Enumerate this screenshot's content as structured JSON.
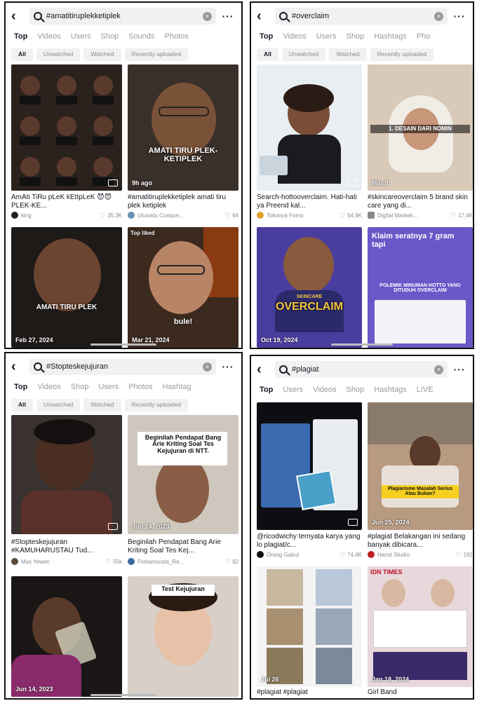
{
  "panels": [
    {
      "query": "#amatitiruplekketiplek",
      "tabs": [
        "Top",
        "Videos",
        "Users",
        "Shop",
        "Sounds",
        "Photos"
      ],
      "chips": [
        "All",
        "Unwatched",
        "Watched",
        "Recently uploaded"
      ],
      "cards": [
        {
          "overlay": "",
          "label": "",
          "caption": "AmAti TiRu pLeK kEtIpLeK 😈😈 PLEK-KE...",
          "user": "king",
          "likes": "35,3K"
        },
        {
          "overlay": "AMATI TIRU PLEK-KETIPLEK",
          "label": "9h ago",
          "caption": "#amatitiruplekketiplek amati tiru plek ketiplek",
          "user": "Uluwatu Conque...",
          "likes": "64"
        },
        {
          "overlay": "AMATI TIRU PLEK",
          "label": "Feb 27, 2024",
          "caption": "",
          "user": "",
          "likes": ""
        },
        {
          "overlay": "bule!",
          "label": "Mar 21, 2024",
          "badge": "Top liked",
          "caption": "",
          "user": "",
          "likes": ""
        }
      ]
    },
    {
      "query": "#overclaim",
      "tabs": [
        "Top",
        "Videos",
        "Users",
        "Shop",
        "Hashtags",
        "Pho"
      ],
      "chips": [
        "All",
        "Unwatched",
        "Watched",
        "Recently uploaded"
      ],
      "cards": [
        {
          "overlay": "",
          "label": "",
          "caption": "Search-hottooverclaim. Hati-hati ya Preend kal...",
          "user": "Tokonya Fomo",
          "likes": "54,9K"
        },
        {
          "overlay": "1. DESAIN DARI NOMIN",
          "label": "Mar 8",
          "caption": "#skincareoverclaim 5 brand skin care yang di...",
          "user": "Digital Marketi...",
          "likes": "17,4K"
        },
        {
          "overlay": "OVERCLAIM",
          "sub": "SKINCARE",
          "label": "Oct 19, 2024",
          "caption": "",
          "user": "",
          "likes": ""
        },
        {
          "overlay": "Klaim seratnya 7 gram tapi",
          "sub": "POLEMIK MINUMAN HOTTO YANG DITUDUH OVERCLAIM",
          "label": "",
          "caption": "",
          "user": "",
          "likes": ""
        }
      ]
    },
    {
      "query": "#Stopteskejujuran",
      "tabs": [
        "Top",
        "Videos",
        "Shop",
        "Users",
        "Photos",
        "Hashtag"
      ],
      "chips": [
        "All",
        "Unwatched",
        "Watched",
        "Recently uploaded"
      ],
      "cards": [
        {
          "overlay": "",
          "label": "",
          "caption": "#Stopteskejujuran #KAMUHARUSTAU Tud...",
          "user": "Mas Yewen",
          "likes": "55k"
        },
        {
          "overlay": "Beginilah Pendapat Bang Arie Kriting Soal Tes Kejujuran di NTT.",
          "label": "Jun 14, 2023",
          "caption": "Beginilah Pendapat Bang Arie Kriting Soal Tes Kej...",
          "user": "Flobamorata_Re...",
          "likes": "92"
        },
        {
          "overlay": "",
          "label": "Jun 14, 2023",
          "caption": "",
          "user": "",
          "likes": ""
        },
        {
          "overlay": "Test Kejujuran",
          "label": "",
          "caption": "",
          "user": "",
          "likes": ""
        }
      ]
    },
    {
      "query": "#plagiat",
      "tabs": [
        "Top",
        "Users",
        "Videos",
        "Shop",
        "Hashtags",
        "LIVE"
      ],
      "chips": [],
      "cards": [
        {
          "overlay": "",
          "label": "",
          "caption": "@ricodwichy ternyata karya yang lo plagiat/c...",
          "user": "Orang Gabut",
          "likes": "74,4K"
        },
        {
          "overlay": "Plagiarisme Masalah Serius Atau Bukan?",
          "label": "Jun 25, 2024",
          "caption": "#plagiat Belakangan ini sedang banyak dibicara...",
          "user": "Hanst Studio",
          "likes": "191"
        },
        {
          "overlay": "",
          "label": "Jul 26",
          "caption": "#plagiat #plagiat",
          "user": "",
          "likes": ""
        },
        {
          "overlay": "IDN TIMES",
          "label": "Jan 18, 2024",
          "caption": "Girl Band",
          "user": "",
          "likes": ""
        }
      ]
    }
  ],
  "colors": {
    "text": "#161823",
    "muted": "#8a8a90",
    "chip_bg": "#f1f1f2"
  }
}
